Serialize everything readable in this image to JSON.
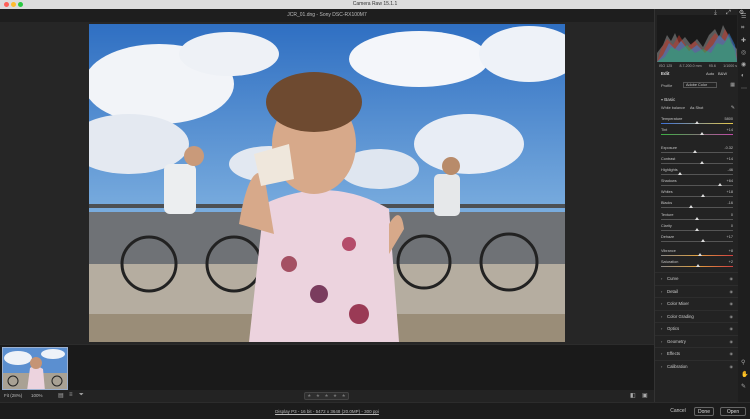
{
  "window": {
    "title": "Camera Raw 15.1.1"
  },
  "file": {
    "title": "JCR_01.dng  -  Sony DSC-RX100M7"
  },
  "toolbar": {
    "fit_label": "Fit (28%)",
    "zoom_label": "100%",
    "stars": [
      "★",
      "★",
      "★",
      "★",
      "★"
    ]
  },
  "footer": {
    "info": "Display P3 - 16 bit - 5472 x 3648 (20.0MP) - 300 ppi",
    "cancel": "Cancel",
    "done": "Done",
    "open": "Open"
  },
  "panel": {
    "hist_info": [
      "ISO 125",
      "8.7-200.0 mm",
      "f/5.6",
      "1/1000 s"
    ],
    "edit_title": "Edit",
    "auto_label": "Auto",
    "bw_label": "B&W",
    "profile_label": "Profile",
    "profile_value": "Adobe Color",
    "basic_title": "Basic",
    "wb_label": "White balance",
    "wb_value": "As Shot",
    "sliders": [
      {
        "label": "Temperature",
        "value": "5800",
        "pos": 0.5
      },
      {
        "label": "Tint",
        "value": "+14",
        "pos": 0.57
      },
      {
        "label": "Exposure",
        "value": "-0.32",
        "pos": 0.47
      },
      {
        "label": "Contrast",
        "value": "+14",
        "pos": 0.57
      },
      {
        "label": "Highlights",
        "value": "-46",
        "pos": 0.27
      },
      {
        "label": "Shadows",
        "value": "+64",
        "pos": 0.82
      },
      {
        "label": "Whites",
        "value": "+18",
        "pos": 0.59
      },
      {
        "label": "Blacks",
        "value": "-16",
        "pos": 0.42
      },
      {
        "label": "Texture",
        "value": "0",
        "pos": 0.5
      },
      {
        "label": "Clarity",
        "value": "0",
        "pos": 0.5
      },
      {
        "label": "Dehaze",
        "value": "+17",
        "pos": 0.58
      },
      {
        "label": "Vibrance",
        "value": "+8",
        "pos": 0.54
      },
      {
        "label": "Saturation",
        "value": "+2",
        "pos": 0.51
      }
    ],
    "sections": [
      "Curve",
      "Detail",
      "Color Mixer",
      "Color Grading",
      "Optics",
      "Geometry",
      "Effects",
      "Calibration"
    ]
  },
  "colors": {
    "accent": "#1473e6",
    "panel_bg": "#232323"
  }
}
